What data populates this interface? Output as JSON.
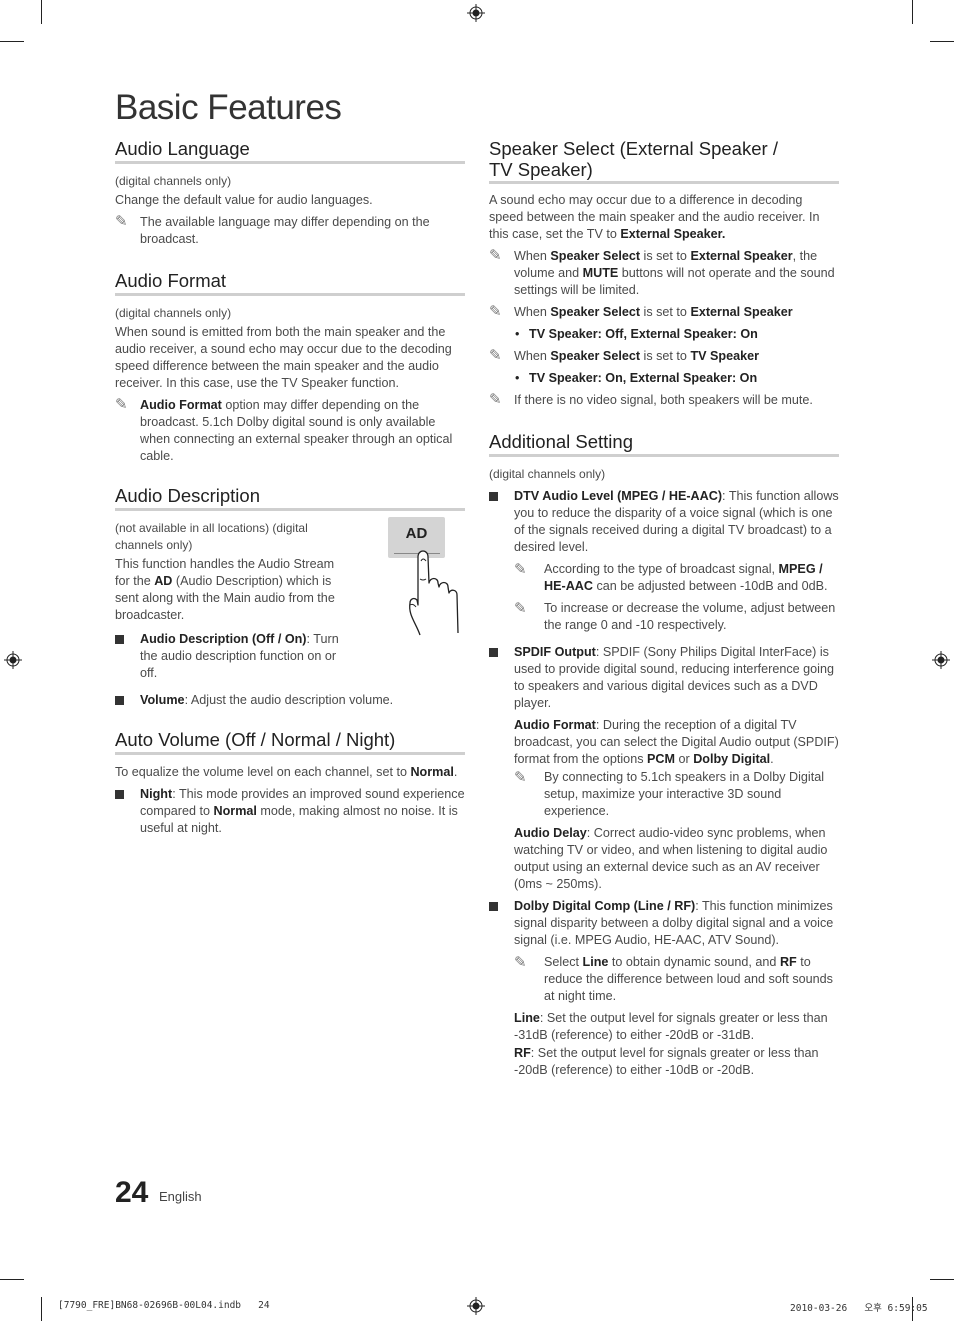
{
  "page": {
    "title": "Basic Features",
    "page_number": "24",
    "language": "English",
    "print_info_left": "[7790_FRE]BN68-02696B-00L04.indb   24",
    "print_info_right": "2010-03-26   오후 6:59:05"
  },
  "left": {
    "audio_language": {
      "heading": "Audio Language",
      "scope": "(digital channels only)",
      "body": "Change the default value for audio languages.",
      "note": "The available language may differ depending on the broadcast."
    },
    "audio_format": {
      "heading": "Audio Format",
      "scope": "(digital channels only)",
      "body": "When sound is emitted from both the main speaker and the audio receiver, a sound echo may occur due to the decoding speed difference between the main speaker and the audio receiver. In this case, use the TV Speaker function.",
      "note_bold": "Audio Format",
      "note_rest": " option may differ depending on the broadcast. 5.1ch Dolby digital sound is only available when connecting an external speaker through an optical cable."
    },
    "audio_description": {
      "heading": "Audio Description",
      "scope": "(not available in all locations) (digital channels only)",
      "body_pre": "This function handles the Audio Stream for the ",
      "body_bold": "AD",
      "body_post": " (Audio Description) which is sent along with the Main audio from the broadcaster.",
      "button_label": "AD",
      "bullets": [
        {
          "bold": "Audio Description (Off / On)",
          "rest": ": Turn the audio description function on or off."
        },
        {
          "bold": "Volume",
          "rest": ": Adjust the audio description volume."
        }
      ]
    },
    "auto_volume": {
      "heading": "Auto Volume (Off / Normal / Night)",
      "body_pre": "To equalize the volume level on each channel, set to ",
      "body_bold": "Normal",
      "body_post": ".",
      "bullet_bold": "Night",
      "bullet_mid": ": This mode provides an improved sound experience compared to ",
      "bullet_bold2": "Normal",
      "bullet_post": " mode, making almost no noise. It is useful at night."
    }
  },
  "right": {
    "speaker_select": {
      "heading": "Speaker Select (External Speaker / TV Speaker)",
      "body_pre": "A sound echo may occur due to a difference in decoding speed between the main speaker and the audio receiver. In this case, set the TV to ",
      "body_bold": "External Speaker.",
      "note1": {
        "p1": "When ",
        "b1": "Speaker Select",
        "p2": " is set to ",
        "b2": "External Speaker",
        "p3": ", the volume and ",
        "b3": "MUTE",
        "p4": " buttons will not operate and the sound settings will be limited."
      },
      "note2": {
        "p1": "When ",
        "b1": "Speaker Select",
        "p2": " is set to ",
        "b2": "External Speaker"
      },
      "note2_item": "TV Speaker: Off, External Speaker: On",
      "note3": {
        "p1": "When ",
        "b1": "Speaker Select",
        "p2": " is set to ",
        "b2": "TV Speaker"
      },
      "note3_item": "TV Speaker: On, External Speaker: On",
      "note4": "If there is no video signal, both speakers will be mute."
    },
    "additional_setting": {
      "heading": "Additional Setting",
      "scope": "(digital channels only)",
      "dtv": {
        "bold": "DTV Audio Level (MPEG / HE-AAC)",
        "rest": ": This function allows you to reduce the disparity of a voice signal (which is one of the signals received during a digital TV broadcast) to a desired level.",
        "note1_pre": "According to the type of broadcast signal, ",
        "note1_bold": "MPEG / HE-AAC",
        "note1_post": " can be adjusted between -10dB and 0dB.",
        "note2": "To increase or decrease the volume, adjust between the range 0 and -10 respectively."
      },
      "spdif": {
        "bold": "SPDIF Output",
        "rest": ": SPDIF (Sony Philips Digital InterFace) is used to provide digital sound, reducing interference going to speakers and various digital devices such as a DVD player.",
        "format_bold": "Audio Format",
        "format_rest": ": During the reception of a digital TV broadcast, you can select the Digital Audio output (SPDIF) format from the options ",
        "format_b2": "PCM",
        "format_or": " or ",
        "format_b3": "Dolby Digital",
        "format_end": ".",
        "format_note": "By connecting to 5.1ch speakers in a Dolby Digital setup, maximize your interactive 3D sound experience.",
        "delay_bold": "Audio Delay",
        "delay_rest": ": Correct audio-video sync problems, when watching TV or video, and when listening to digital audio output using an external device such as an AV receiver (0ms ~ 250ms)."
      },
      "dolby": {
        "bold": "Dolby Digital Comp (Line / RF)",
        "rest": ": This function minimizes signal disparity between a dolby digital signal and a voice signal (i.e. MPEG Audio, HE-AAC, ATV Sound).",
        "note_p1": "Select ",
        "note_b1": "Line",
        "note_p2": " to obtain dynamic sound, and ",
        "note_b2": "RF",
        "note_p3": " to reduce the difference between loud and soft sounds at night time.",
        "line_bold": "Line",
        "line_rest": ": Set the output level for signals greater or less than -31dB (reference) to either -20dB or -31dB.",
        "rf_bold": "RF",
        "rf_rest": ": Set the output level for signals greater or less than -20dB (reference) to either -10dB or -20dB."
      }
    }
  },
  "icons": {
    "note": "✎",
    "bullet_dot": "•"
  }
}
